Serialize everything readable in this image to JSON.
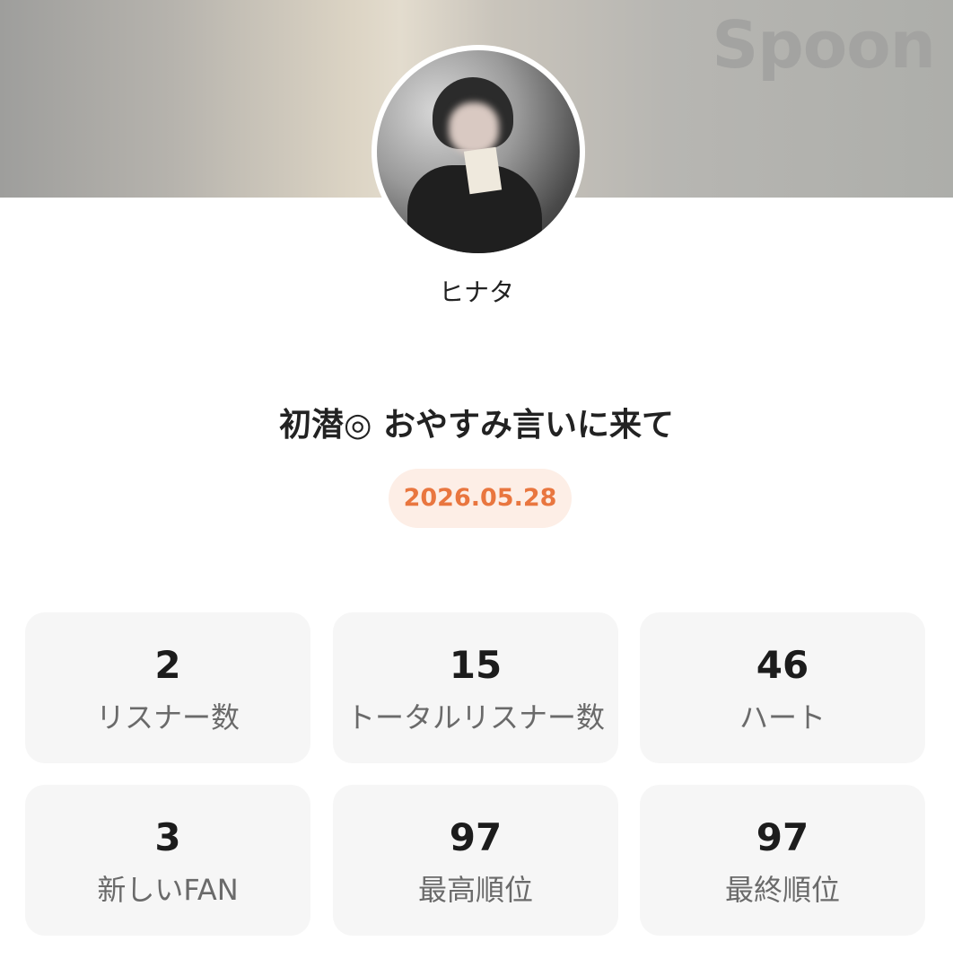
{
  "header": {
    "brand": "Spoon"
  },
  "profile": {
    "username": "ヒナタ"
  },
  "broadcast": {
    "title": "初潜◎ おやすみ言いに来て",
    "date": "2026.05.28"
  },
  "stats": [
    {
      "value": "2",
      "label": "リスナー数"
    },
    {
      "value": "15",
      "label": "トータルリスナー数"
    },
    {
      "value": "46",
      "label": "ハート"
    },
    {
      "value": "3",
      "label": "新しいFAN"
    },
    {
      "value": "97",
      "label": "最高順位"
    },
    {
      "value": "97",
      "label": "最終順位"
    }
  ],
  "colors": {
    "accent": "#e9763f",
    "date_pill_bg": "#fdeee6",
    "card_bg": "#f6f6f6"
  }
}
